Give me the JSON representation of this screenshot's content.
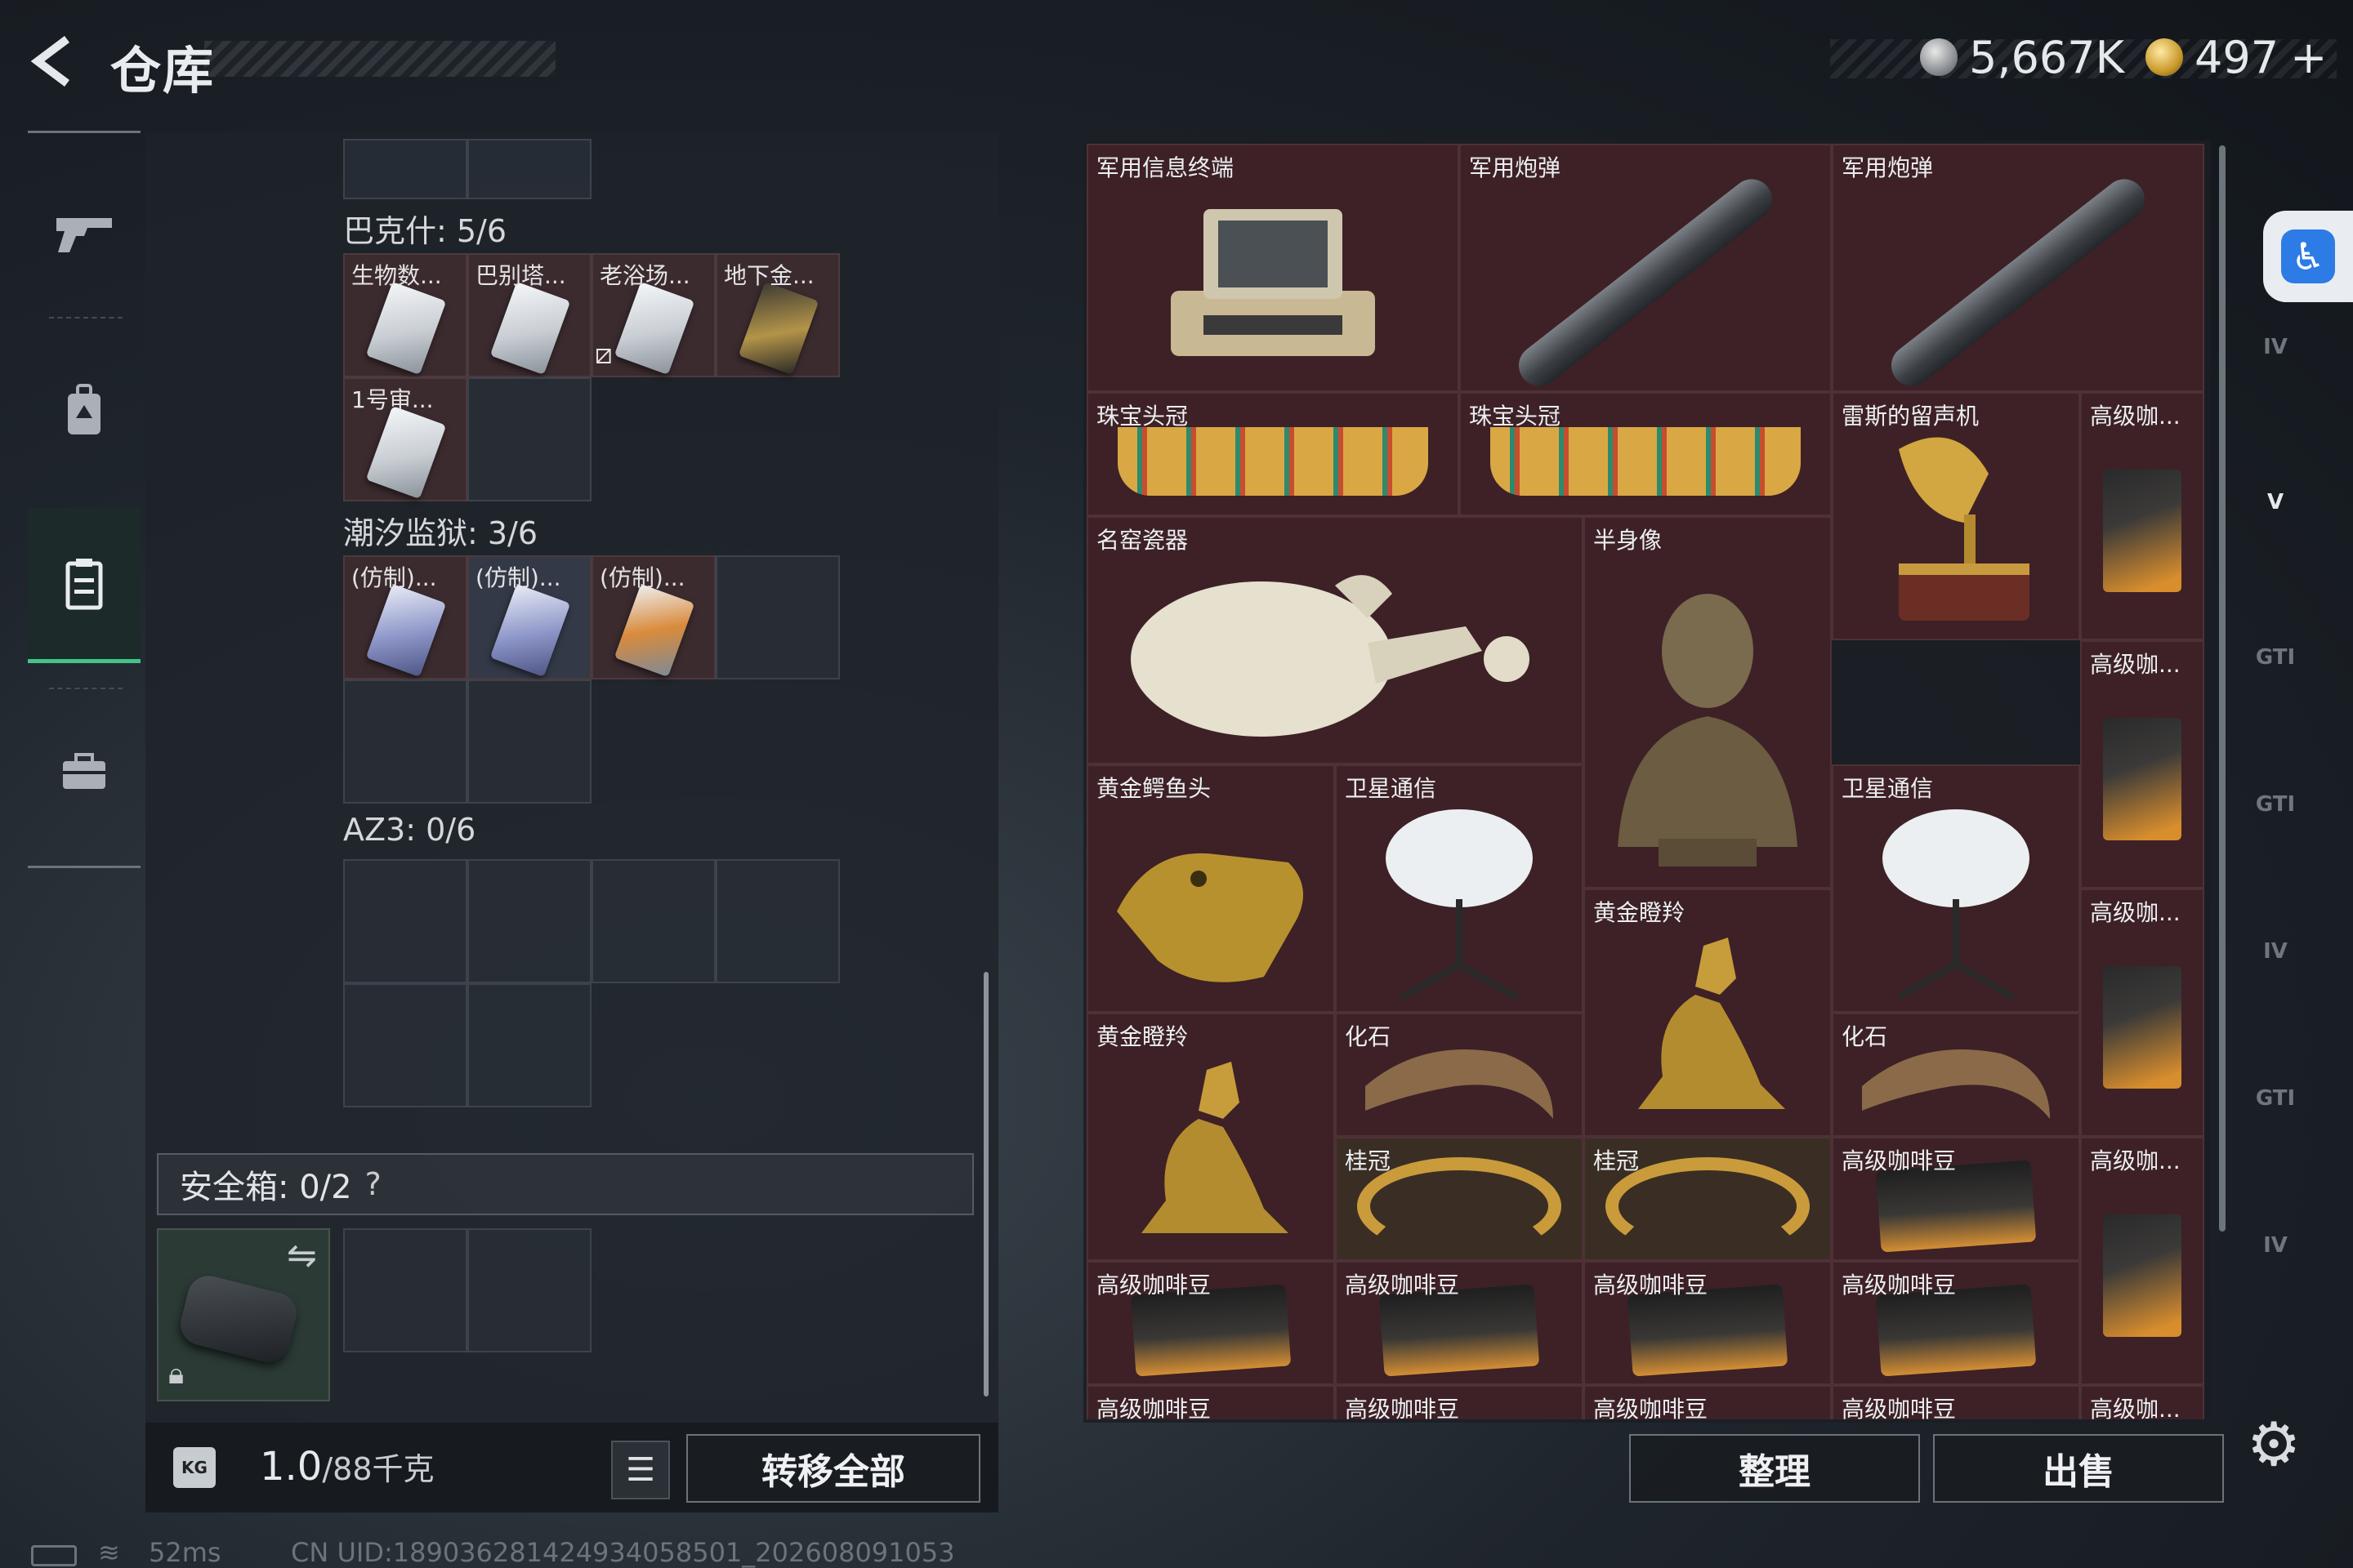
{
  "header": {
    "title": "仓库",
    "currency_silver": "5,667K",
    "currency_gold": "497",
    "currency_gold_plus": "+"
  },
  "left": {
    "sections": [
      {
        "label": "巴克什: 5/6"
      },
      {
        "label": "潮汐监狱: 3/6"
      },
      {
        "label": "AZ3: 0/6"
      }
    ],
    "bakshi_items": [
      "生物数...",
      "巴别塔...",
      "老浴场...",
      "地下金...",
      "1号审..."
    ],
    "tide_items": [
      "(仿制)...",
      "(仿制)...",
      "(仿制)..."
    ],
    "safe_label": "安全箱: 0/2",
    "safe_help": "?",
    "weight_value": "1.0",
    "weight_unit": "/88千克",
    "weight_icon": "KG",
    "transfer_all": "转移全部"
  },
  "right": {
    "items": [
      {
        "label": "军用信息终端"
      },
      {
        "label": "军用炮弹"
      },
      {
        "label": "军用炮弹"
      },
      {
        "label": "珠宝头冠"
      },
      {
        "label": "珠宝头冠"
      },
      {
        "label": "雷斯的留声机"
      },
      {
        "label": "高级咖..."
      },
      {
        "label": "名窑瓷器"
      },
      {
        "label": "半身像"
      },
      {
        "label": "高级咖..."
      },
      {
        "label": "黄金鳄鱼头"
      },
      {
        "label": "卫星通信"
      },
      {
        "label": "卫星通信"
      },
      {
        "label": "黄金瞪羚"
      },
      {
        "label": "高级咖..."
      },
      {
        "label": "黄金瞪羚"
      },
      {
        "label": "化石"
      },
      {
        "label": "化石"
      },
      {
        "label": "桂冠"
      },
      {
        "label": "桂冠"
      },
      {
        "label": "高级咖啡豆"
      },
      {
        "label": "高级咖..."
      },
      {
        "label": "高级咖啡豆"
      },
      {
        "label": "高级咖啡豆"
      },
      {
        "label": "高级咖啡豆"
      },
      {
        "label": "高级咖啡豆"
      },
      {
        "label": "高级咖啡豆"
      },
      {
        "label": "高级咖啡豆"
      },
      {
        "label": "高级咖啡豆"
      },
      {
        "label": "高级咖啡豆"
      },
      {
        "label": "高级咖..."
      }
    ],
    "sort_button": "整理",
    "sell_button": "出售"
  },
  "filters": [
    "IV",
    "V",
    "GTI",
    "GTI",
    "IV",
    "GTI",
    "IV"
  ],
  "status": {
    "ping": "52ms",
    "uid": "CN UID:18903628142493405850​1_202608091053"
  },
  "colors": {
    "accent_green": "#42c389",
    "item_bg": "#3d2126",
    "access_blue": "#2d7be5"
  }
}
